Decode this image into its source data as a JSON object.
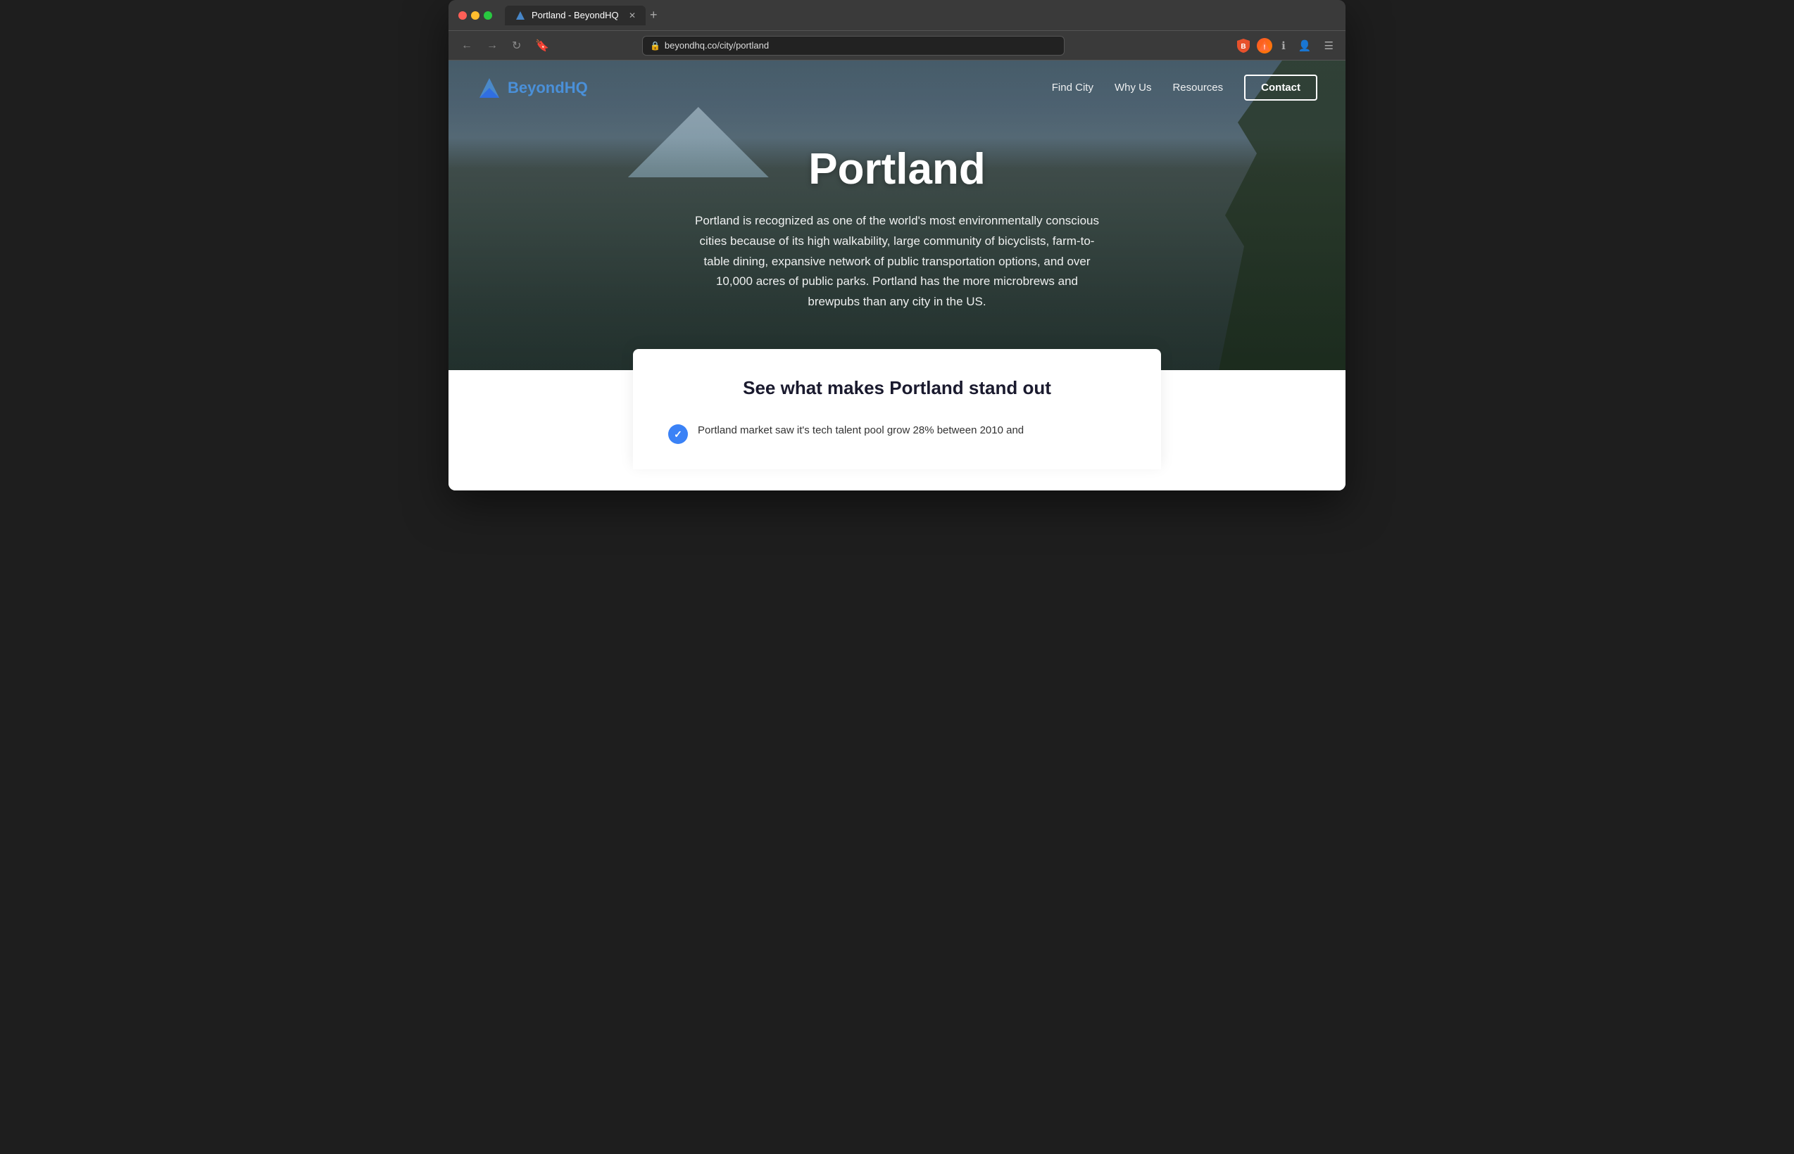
{
  "browser": {
    "tab_title": "Portland - BeyondHQ",
    "url": "beyondhq.co/city/portland",
    "back_btn": "←",
    "forward_btn": "→",
    "reload_btn": "↻"
  },
  "nav": {
    "logo_text": "BeyondHQ",
    "find_city": "Find City",
    "why_us": "Why Us",
    "resources": "Resources",
    "contact": "Contact"
  },
  "hero": {
    "city_name": "Portland",
    "description": "Portland is recognized as one of the world's most environmentally conscious cities because of its high walkability, large community of bicyclists, farm-to-table dining, expansive network of public transportation options, and over 10,000 acres of public parks. Portland has the more microbrews and brewpubs than any city in the US."
  },
  "standout": {
    "heading": "See what makes Portland stand out",
    "feature_1": "Portland market saw it's tech talent pool grow 28% between 2010 and"
  }
}
